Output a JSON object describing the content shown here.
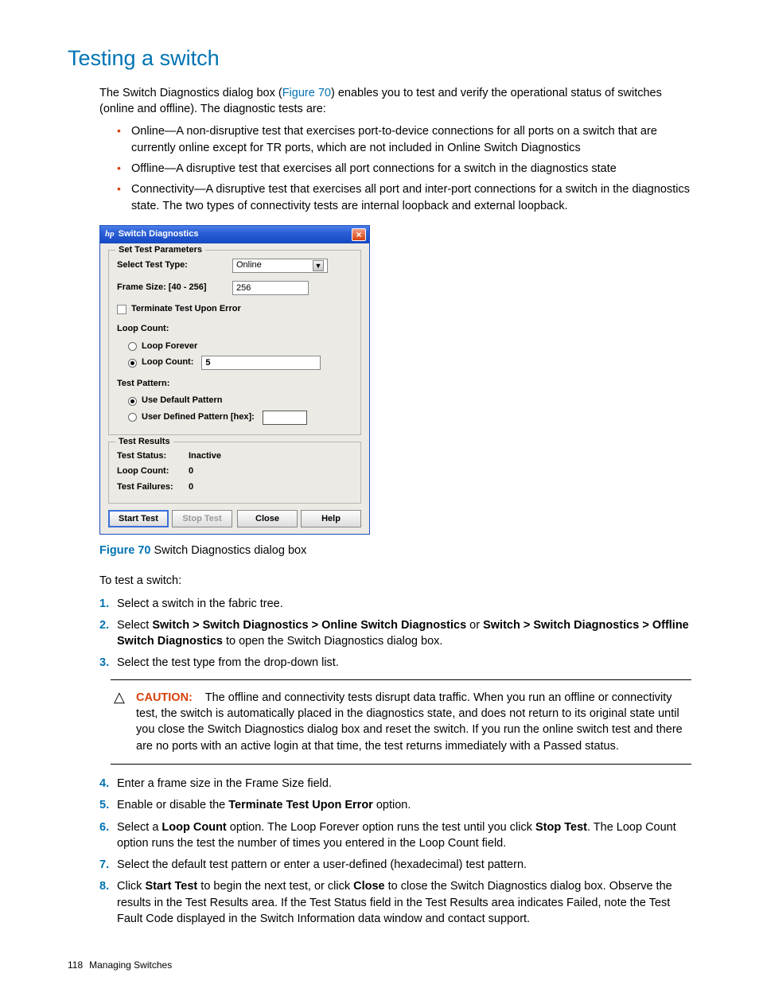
{
  "heading": "Testing a switch",
  "intro_a": "The Switch Diagnostics dialog box (",
  "intro_link": "Figure 70",
  "intro_b": ") enables you to test and verify the operational status of switches (online and offline). The diagnostic tests are:",
  "bullets": [
    "Online—A non-disruptive test that exercises port-to-device connections for all ports on a switch that are currently online except for TR ports, which are not included in Online Switch Diagnostics",
    "Offline—A disruptive test that exercises all port connections for a switch in the diagnostics state",
    "Connectivity—A disruptive test that exercises all port and inter-port connections for a switch in the diagnostics state. The two types of connectivity tests are internal loopback and external loopback."
  ],
  "dialog": {
    "logo": "hp",
    "title": "Switch Diagnostics",
    "close": "×",
    "params_legend": "Set Test Parameters",
    "select_type_label": "Select Test Type:",
    "select_type_value": "Online",
    "arrow": "▼",
    "frame_label": "Frame Size: [40 - 256]",
    "frame_value": "256",
    "terminate_label": "Terminate Test Upon Error",
    "loop_count_h": "Loop Count:",
    "loop_forever": "Loop Forever",
    "loop_count_label": "Loop Count:",
    "loop_count_value": "5",
    "pattern_h": "Test Pattern:",
    "use_default": "Use Default Pattern",
    "user_defined": "User Defined Pattern [hex]:",
    "results_legend": "Test Results",
    "status_k": "Test Status:",
    "status_v": "Inactive",
    "loop_k": "Loop Count:",
    "loop_v": "0",
    "fail_k": "Test Failures:",
    "fail_v": "0",
    "btn_start": "Start Test",
    "btn_stop": "Stop Test",
    "btn_close": "Close",
    "btn_help": "Help"
  },
  "fig_label": "Figure 70",
  "fig_caption": " Switch Diagnostics dialog box",
  "to_test": "To test a switch:",
  "steps": {
    "s1": "Select a switch in the fabric tree.",
    "s2a": "Select ",
    "s2b1": "Switch > Switch Diagnostics > Online Switch Diagnostics",
    "s2c": " or ",
    "s2b2": "Switch > Switch Diagnostics > Offline Switch Diagnostics",
    "s2d": " to open the Switch Diagnostics dialog box.",
    "s3": "Select the test type from the drop-down list.",
    "s4": "Enter a frame size in the Frame Size field.",
    "s5a": "Enable or disable the ",
    "s5b": "Terminate Test Upon Error",
    "s5c": " option.",
    "s6a": "Select a ",
    "s6b": "Loop Count",
    "s6c": " option. The Loop Forever option runs the test until you click ",
    "s6d": "Stop Test",
    "s6e": ". The Loop Count option runs the test the number of times you entered in the Loop Count field.",
    "s7": "Select the default test pattern or enter a user-defined (hexadecimal) test pattern.",
    "s8a": "Click ",
    "s8b": "Start Test",
    "s8c": " to begin the next test, or click ",
    "s8d": "Close",
    "s8e": " to close the Switch Diagnostics dialog box. Observe the results in the Test Results area. If the Test Status field in the Test Results area indicates Failed, note the Test Fault Code displayed in the Switch Information data window and contact support."
  },
  "caution_label": "CAUTION:",
  "caution_text": "The offline and connectivity tests disrupt data traffic. When you run an offline or connectivity test, the switch is automatically placed in the diagnostics state, and does not return to its original state until you close the Switch Diagnostics dialog box and reset the switch. If you run the online switch test and there are no ports with an active login at that time, the test returns immediately with a Passed status.",
  "footer_page": "118",
  "footer_section": "Managing Switches"
}
